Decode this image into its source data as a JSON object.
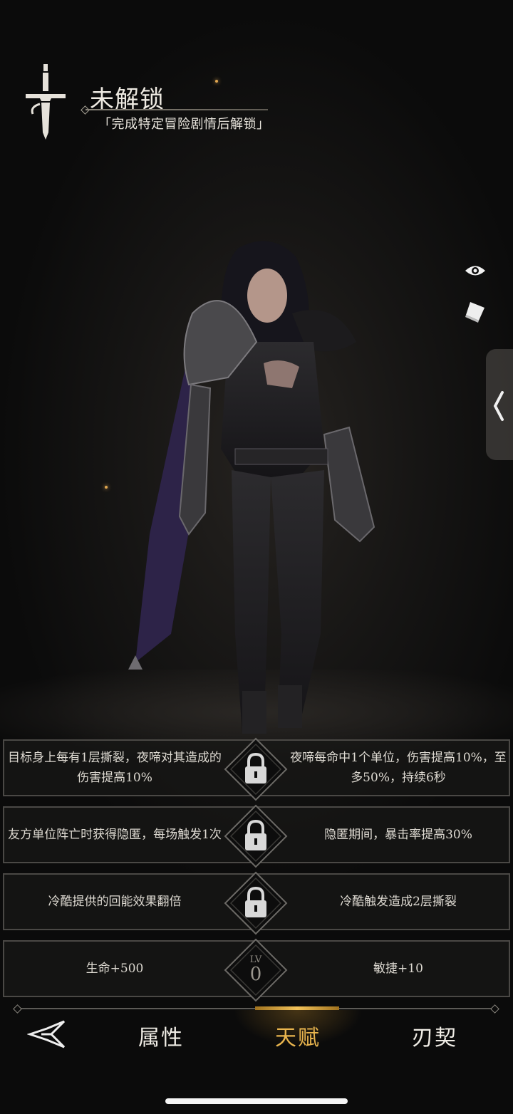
{
  "header": {
    "status": "未解锁",
    "hint": "「完成特定冒险剧情后解锁」",
    "icon": "sword-emblem-icon"
  },
  "side_controls": {
    "view_icon": "eye-icon",
    "book_icon": "book-icon",
    "drawer_icon": "chevron-left-icon"
  },
  "talents": [
    {
      "left": "目标身上每有1层撕裂，夜啼对其造成的伤害提高10%",
      "right": "夜啼每命中1个单位，伤害提高10%，至多50%，持续6秒",
      "node": "lock"
    },
    {
      "left": "友方单位阵亡时获得隐匿，每场触发1次",
      "right": "隐匿期间，暴击率提高30%",
      "node": "lock"
    },
    {
      "left": "冷酷提供的回能效果翻倍",
      "right": "冷酷触发造成2层撕裂",
      "node": "lock"
    },
    {
      "left": "生命+500",
      "right": "敏捷+10",
      "node": "level"
    }
  ],
  "level_node": {
    "label": "LV",
    "value": "0"
  },
  "nav": {
    "items": [
      "属性",
      "天赋",
      "刃契"
    ],
    "active": "天赋",
    "accent": "#e9b54e"
  }
}
